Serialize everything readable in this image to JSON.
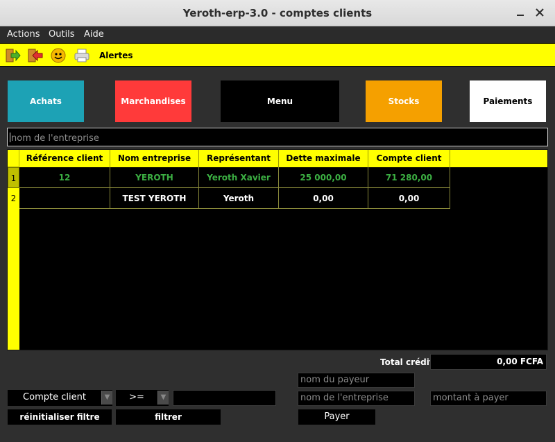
{
  "window": {
    "title": "Yeroth-erp-3.0 - comptes clients"
  },
  "menubar": {
    "items": [
      "Actions",
      "Outils",
      "Aide"
    ]
  },
  "toolbar": {
    "icons": [
      "exit-icon",
      "back-icon",
      "smiley-icon",
      "printer-icon"
    ],
    "alertes_label": "Alertes"
  },
  "nav": {
    "achats": {
      "label": "Achats",
      "color": "#1da2b5"
    },
    "marchandises": {
      "label": "Marchandises",
      "color": "#ff3a3a"
    },
    "menu": {
      "label": "Menu",
      "color": "#000000"
    },
    "stocks": {
      "label": "Stocks",
      "color": "#f5a000"
    },
    "paiements": {
      "label": "Paiements",
      "color": "#ffffff"
    }
  },
  "search": {
    "placeholder": "nom de l'entreprise"
  },
  "table": {
    "columns": [
      "Référence client",
      "Nom entreprise",
      "Représentant",
      "Dette maximale",
      "Compte client"
    ],
    "rows": [
      {
        "num": "1",
        "ref": "12",
        "nom": "YEROTH",
        "rep": "Yeroth Xavier",
        "dette": "25 000,00",
        "compte": "71 280,00"
      },
      {
        "num": "2",
        "ref": "",
        "nom": "TEST YEROTH",
        "rep": "Yeroth",
        "dette": "0,00",
        "compte": "0,00"
      }
    ]
  },
  "footer": {
    "total_label": "Total crédit",
    "total_value": "0,00 FCFA",
    "payeur_placeholder": "nom du payeur",
    "entreprise_placeholder": "nom de l'entreprise",
    "montant_placeholder": "montant à payer",
    "filter_field": "Compte client",
    "filter_op": ">=",
    "reset_label": "réinitialiser filtre",
    "filter_label": "filtrer",
    "pay_label": "Payer"
  },
  "colors": {
    "accent": "#ffff00",
    "green_text": "#3cb043"
  }
}
